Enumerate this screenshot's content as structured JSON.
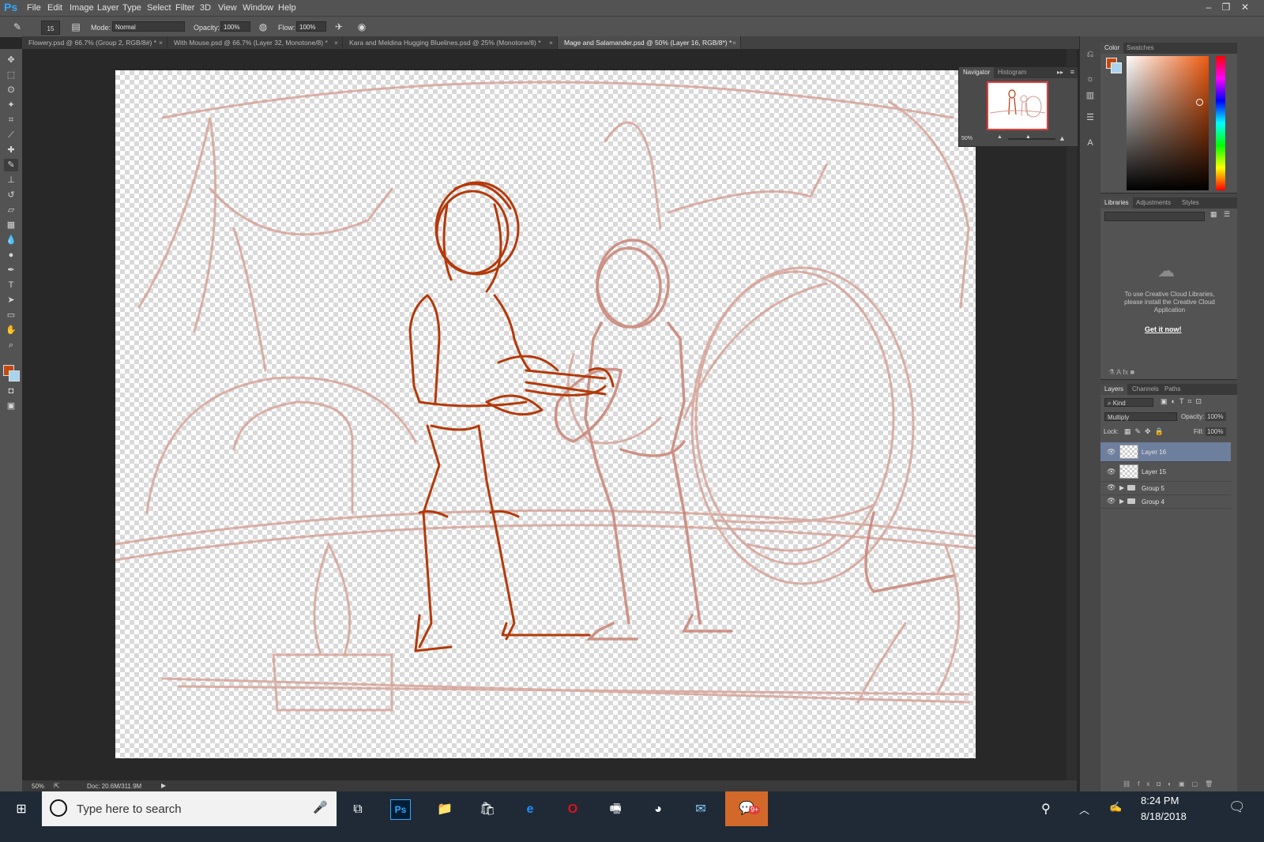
{
  "app": {
    "logo": "Ps"
  },
  "menu": [
    "File",
    "Edit",
    "Image",
    "Layer",
    "Type",
    "Select",
    "Filter",
    "3D",
    "View",
    "Window",
    "Help"
  ],
  "options": {
    "brush_size": "15",
    "mode_label": "Mode:",
    "mode_value": "Normal",
    "opacity_label": "Opacity:",
    "opacity_value": "100%",
    "flow_label": "Flow:",
    "flow_value": "100%"
  },
  "tabs": [
    {
      "label": "Flowery.psd @ 66.7% (Group 2, RGB/8#) *"
    },
    {
      "label": "With Mouse.psd @ 66.7% (Layer 32, Monotone/8) *"
    },
    {
      "label": "Kara and Meldina Hugging Bluelines.psd @ 25% (Monotone/8) *"
    },
    {
      "label": "Mage and Salamander.psd @ 50% (Layer 16, RGB/8*) *"
    }
  ],
  "status": {
    "zoom": "50%",
    "doc": "Doc: 20.6M/311.9M"
  },
  "navigator": {
    "tab1": "Navigator",
    "tab2": "Histogram",
    "zoom": "50%"
  },
  "color_panel": {
    "tab1": "Color",
    "tab2": "Swatches",
    "foreground": "#c24a12",
    "background": "#a8d4ee"
  },
  "libraries": {
    "tab1": "Libraries",
    "tab2": "Adjustments",
    "tab3": "Styles",
    "message": "To use Creative Cloud Libraries, please install the Creative Cloud Application",
    "link": "Get it now!"
  },
  "layers": {
    "tab1": "Layers",
    "tab2": "Channels",
    "tab3": "Paths",
    "filter": "Kind",
    "blend_mode": "Multiply",
    "opacity_label": "Opacity:",
    "opacity_value": "100%",
    "lock_label": "Lock:",
    "fill_label": "Fill:",
    "fill_value": "100%",
    "items": [
      {
        "name": "Layer 16",
        "type": "layer",
        "selected": true
      },
      {
        "name": "Layer 15",
        "type": "layer",
        "selected": false
      },
      {
        "name": "Group 5",
        "type": "group",
        "selected": false
      },
      {
        "name": "Group 4",
        "type": "group",
        "selected": false
      }
    ]
  },
  "taskbar": {
    "search_placeholder": "Type here to search",
    "time": "8:24 PM",
    "date": "8/18/2018",
    "badge": "9+"
  },
  "colors": {
    "sketch_dark": "#b33a0b",
    "sketch_light": "#cf8a7c",
    "accent_selected": "#6e7f9e"
  }
}
